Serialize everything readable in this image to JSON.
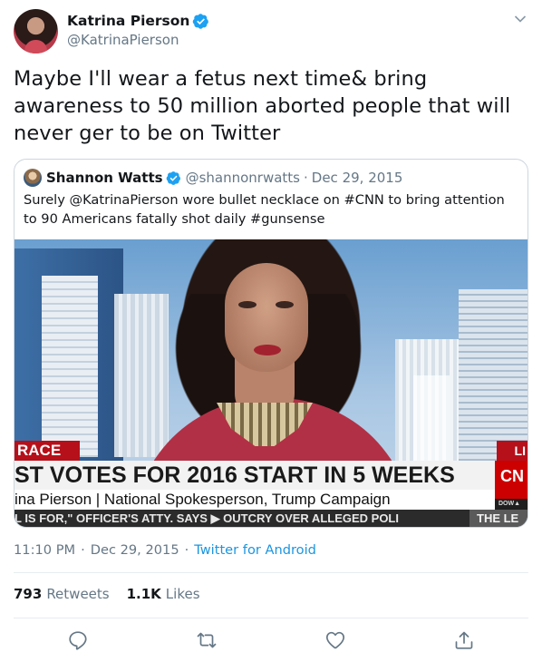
{
  "author": {
    "name": "Katrina Pierson",
    "handle": "@KatrinaPierson",
    "verified": true
  },
  "tweet": {
    "text": "Maybe I'll wear a fetus next time& bring awareness to 50 million aborted people that will never ger to be on Twitter",
    "time": "11:10 PM",
    "date": "Dec 29, 2015",
    "separator": "·",
    "source": "Twitter for Android"
  },
  "quoted": {
    "name": "Shannon Watts",
    "handle": "@shannonrwatts",
    "separator": "·",
    "date": "Dec 29, 2015",
    "verified": true,
    "text": "Surely @KatrinaPierson wore bullet necklace on #CNN to bring attention to 90 Americans fatally shot daily #gunsense",
    "media": {
      "tag_left": "RACE",
      "tag_right": "LI",
      "headline": "ST VOTES FOR 2016 START IN 5 WEEKS",
      "lower_third": "ina Pierson | National Spokesperson, Trump Campaign",
      "logo": "CN",
      "market": "DOW▲",
      "ticker": "L IS FOR,\" OFFICER'S ATTY. SAYS  ▶  OUTCRY OVER ALLEGED POLI",
      "ticker_end": "THE LE"
    }
  },
  "stats": {
    "retweets_count": "793",
    "retweets_label": "Retweets",
    "likes_count": "1.1K",
    "likes_label": "Likes"
  },
  "colors": {
    "accent": "#1b95e0",
    "secondary_text": "#657786",
    "border": "#ccd6dd",
    "verified": "#1da1f2"
  },
  "icons": {
    "caret": "chevron-down-icon",
    "reply": "reply-icon",
    "retweet": "retweet-icon",
    "like": "heart-icon",
    "share": "share-icon",
    "verified": "verified-badge-icon"
  }
}
